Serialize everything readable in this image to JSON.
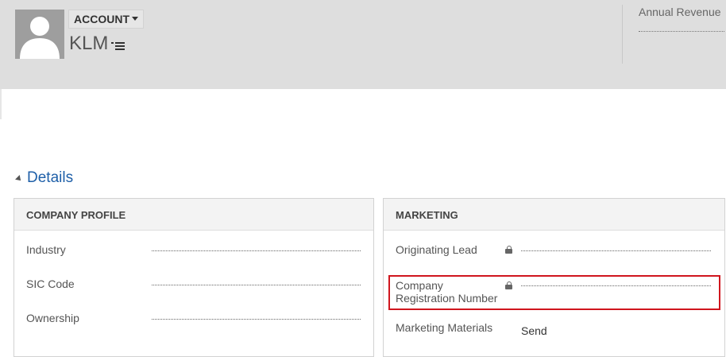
{
  "header": {
    "entity_type": "ACCOUNT",
    "record_name": "KLM",
    "annual_revenue_label": "Annual Revenue",
    "avatar_icon": "user-silhouette-icon",
    "nav_icon": "list-menu-icon"
  },
  "details": {
    "title": "Details",
    "sections": {
      "company_profile": {
        "title": "COMPANY PROFILE",
        "fields": [
          {
            "label": "Industry",
            "value": ""
          },
          {
            "label": "SIC Code",
            "value": ""
          },
          {
            "label": "Ownership",
            "value": ""
          }
        ]
      },
      "marketing": {
        "title": "MARKETING",
        "fields": [
          {
            "label": "Originating Lead",
            "value": "",
            "locked": true
          },
          {
            "label": "Company Registration Number",
            "label_line1": "Company",
            "label_line2": "Registration Number",
            "value": "",
            "locked": true,
            "highlighted": true
          },
          {
            "label": "Marketing Materials",
            "value": "Send",
            "locked": false
          }
        ]
      }
    }
  },
  "colors": {
    "header_bg": "#dedede",
    "link_blue": "#1e5fa8",
    "highlight_red": "#d0161e"
  }
}
